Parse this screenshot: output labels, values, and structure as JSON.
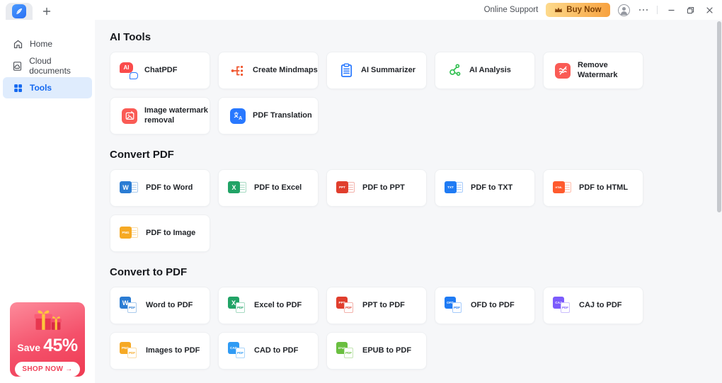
{
  "titlebar": {
    "new_tab_label": "+",
    "online_support": "Online Support",
    "buy_now": "Buy Now"
  },
  "sidebar": {
    "items": [
      {
        "label": "Home",
        "icon": "home-icon",
        "active": false
      },
      {
        "label": "Cloud documents",
        "icon": "cloud-document-icon",
        "active": false
      },
      {
        "label": "Tools",
        "icon": "tools-grid-icon",
        "active": true
      }
    ],
    "promo": {
      "save_label": "Save",
      "discount": "45%",
      "cta": "SHOP NOW →"
    }
  },
  "sections": [
    {
      "title": "AI Tools",
      "tools": [
        {
          "label": "ChatPDF",
          "icon": {
            "name": "chatpdf-icon",
            "type": "chat",
            "color": "#fa4b4b"
          }
        },
        {
          "label": "Create Mindmaps",
          "icon": {
            "name": "create-mindmaps-icon",
            "type": "mindmap",
            "color": "#f0562e"
          }
        },
        {
          "label": "AI Summarizer",
          "icon": {
            "name": "ai-summarizer-icon",
            "type": "clipboard",
            "color": "#2878ff"
          }
        },
        {
          "label": "AI Analysis",
          "icon": {
            "name": "ai-analysis-icon",
            "type": "molecule",
            "color": "#2fbf4f"
          }
        },
        {
          "label": "Remove Watermark",
          "icon": {
            "name": "remove-watermark-icon",
            "type": "watermark",
            "color": "#fa5b55"
          }
        },
        {
          "label": "Image watermark removal",
          "icon": {
            "name": "image-watermark-removal-icon",
            "type": "image-removal",
            "color": "#fa5b55"
          }
        },
        {
          "label": "PDF Translation",
          "icon": {
            "name": "pdf-translation-icon",
            "type": "translate",
            "color": "#2878ff"
          }
        }
      ]
    },
    {
      "title": "Convert PDF",
      "tools": [
        {
          "label": "PDF to Word",
          "icon": {
            "name": "pdf-to-word-icon",
            "type": "pdf-to",
            "letters": "W",
            "color": "#2b7cd3"
          }
        },
        {
          "label": "PDF to Excel",
          "icon": {
            "name": "pdf-to-excel-icon",
            "type": "pdf-to",
            "letters": "X",
            "color": "#21a366"
          }
        },
        {
          "label": "PDF to PPT",
          "icon": {
            "name": "pdf-to-ppt-icon",
            "type": "pdf-to",
            "letters": "PPT",
            "color": "#e03e2d"
          }
        },
        {
          "label": "PDF to TXT",
          "icon": {
            "name": "pdf-to-txt-icon",
            "type": "pdf-to",
            "letters": "TXT",
            "color": "#1f7bf4"
          }
        },
        {
          "label": "PDF to HTML",
          "icon": {
            "name": "pdf-to-html-icon",
            "type": "pdf-to",
            "letters": "HTML",
            "color": "#ff5a2d"
          }
        },
        {
          "label": "PDF to Image",
          "icon": {
            "name": "pdf-to-image-icon",
            "type": "pdf-to",
            "letters": "PNG",
            "color": "#f6a924"
          }
        }
      ]
    },
    {
      "title": "Convert to PDF",
      "tools": [
        {
          "label": "Word to PDF",
          "icon": {
            "name": "word-to-pdf-icon",
            "type": "to-pdf",
            "letters": "W",
            "color": "#2b7cd3"
          }
        },
        {
          "label": "Excel to PDF",
          "icon": {
            "name": "excel-to-pdf-icon",
            "type": "to-pdf",
            "letters": "X",
            "color": "#21a366"
          }
        },
        {
          "label": "PPT to PDF",
          "icon": {
            "name": "ppt-to-pdf-icon",
            "type": "to-pdf",
            "letters": "PPT",
            "color": "#e03e2d"
          }
        },
        {
          "label": "OFD to PDF",
          "icon": {
            "name": "ofd-to-pdf-icon",
            "type": "to-pdf",
            "letters": "OFD",
            "color": "#1f7bf4"
          }
        },
        {
          "label": "CAJ to PDF",
          "icon": {
            "name": "caj-to-pdf-icon",
            "type": "to-pdf",
            "letters": "CAJ",
            "color": "#7c5cfc"
          }
        },
        {
          "label": "Images to PDF",
          "icon": {
            "name": "images-to-pdf-icon",
            "type": "to-pdf",
            "letters": "PNG",
            "color": "#f6a924"
          }
        },
        {
          "label": "CAD to PDF",
          "icon": {
            "name": "cad-to-pdf-icon",
            "type": "to-pdf",
            "letters": "CAD",
            "color": "#2f9bf4"
          }
        },
        {
          "label": "EPUB to PDF",
          "icon": {
            "name": "epub-to-pdf-icon",
            "type": "to-pdf",
            "letters": "EPUB",
            "color": "#6abf40"
          }
        }
      ]
    }
  ],
  "colors": {
    "accent_blue": "#1569f0",
    "active_item_bg": "#dfecfd",
    "content_bg": "#f6f7f9",
    "buy_now_from": "#fdda8c",
    "buy_now_to": "#f7a13f",
    "buy_now_text": "#7d3f04",
    "promo_from": "#fd8b9b",
    "promo_to": "#ef3b52",
    "promo_cta_text": "#f0435a"
  }
}
